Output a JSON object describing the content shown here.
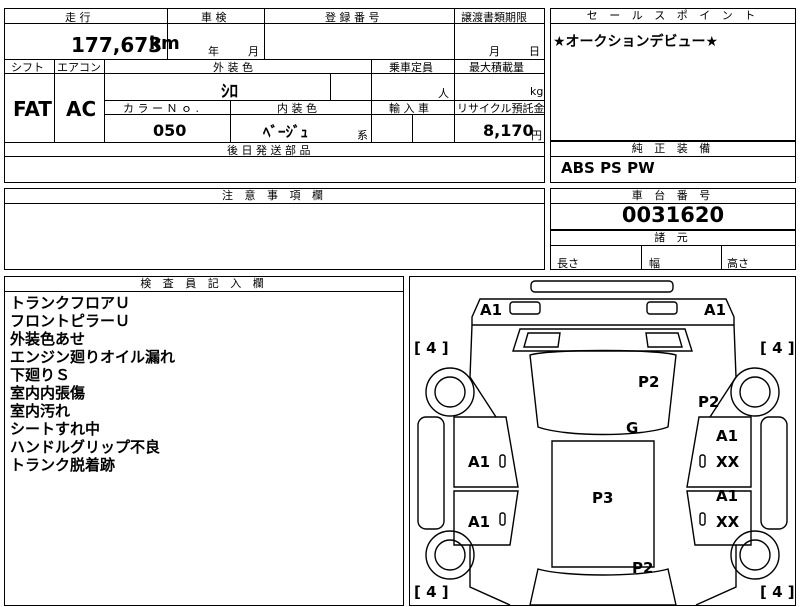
{
  "mileage": {
    "label": "走 行",
    "value": "177,673",
    "unit": "km"
  },
  "shaken": {
    "label": "車 検",
    "year_unit": "年",
    "month_unit": "月"
  },
  "registration": {
    "label": "登 録 番 号"
  },
  "transfer_docs": {
    "label": "譲渡書類期限",
    "month_unit": "月",
    "day_unit": "日"
  },
  "sales_point": {
    "label": "セ ー ル ス ポ イ ン ト",
    "text": "★オークションデビュー★"
  },
  "shift": {
    "label": "シフト",
    "value": "FAT"
  },
  "aircon": {
    "label": "エアコン",
    "value": "AC"
  },
  "exterior_color": {
    "label": "外 装 色",
    "value": "ｼﾛ"
  },
  "capacity": {
    "label": "乗車定員",
    "unit": "人"
  },
  "max_load": {
    "label": "最大積載量",
    "unit": "kg"
  },
  "color_no": {
    "label": "カ ラ ー Ｎ ｏ .",
    "value": "050"
  },
  "interior_color": {
    "label": "内 装 色",
    "value": "ﾍﾞｰｼﾞｭ",
    "suffix": "系"
  },
  "import_car": {
    "label": "輸 入 車"
  },
  "recycle": {
    "label": "リサイクル預託金",
    "value": "8,170",
    "unit": "円"
  },
  "later_parts": {
    "label": "後 日 発 送 部 品"
  },
  "standard_equipment": {
    "label": "純 正 装 備",
    "value": "ABS PS PW"
  },
  "caution": {
    "label": "注 意 事 項 欄"
  },
  "chassis": {
    "label": "車 台 番 号",
    "value": "0031620"
  },
  "dimensions": {
    "label": "諸 元",
    "length": "長さ",
    "width": "幅",
    "height": "高さ"
  },
  "inspector": {
    "label": "検 査 員 記 入 欄",
    "notes": [
      "トランクフロアＵ",
      "フロントピラーＵ",
      "外装色あせ",
      "エンジン廻りオイル漏れ",
      "下廻りＳ",
      "室内内張傷",
      "室内汚れ",
      "シートすれ中",
      "ハンドルグリップ不良",
      "トランク脱着跡"
    ]
  },
  "diagram": {
    "marks": {
      "a1_tl": "A1",
      "a1_tr": "A1",
      "p2_top": "P2",
      "p2_right": "P2",
      "g": "G",
      "a1_left_front": "A1",
      "a1_right_front": "A1",
      "xx_right_front": "XX",
      "p3": "P3",
      "a1_left_rear": "A1",
      "a1_right_rear": "A1",
      "xx_right_rear": "XX",
      "p2_bottom": "P2"
    },
    "tires": {
      "front_left": "4",
      "front_right": "4",
      "rear_left": "4",
      "rear_right": "4"
    }
  }
}
